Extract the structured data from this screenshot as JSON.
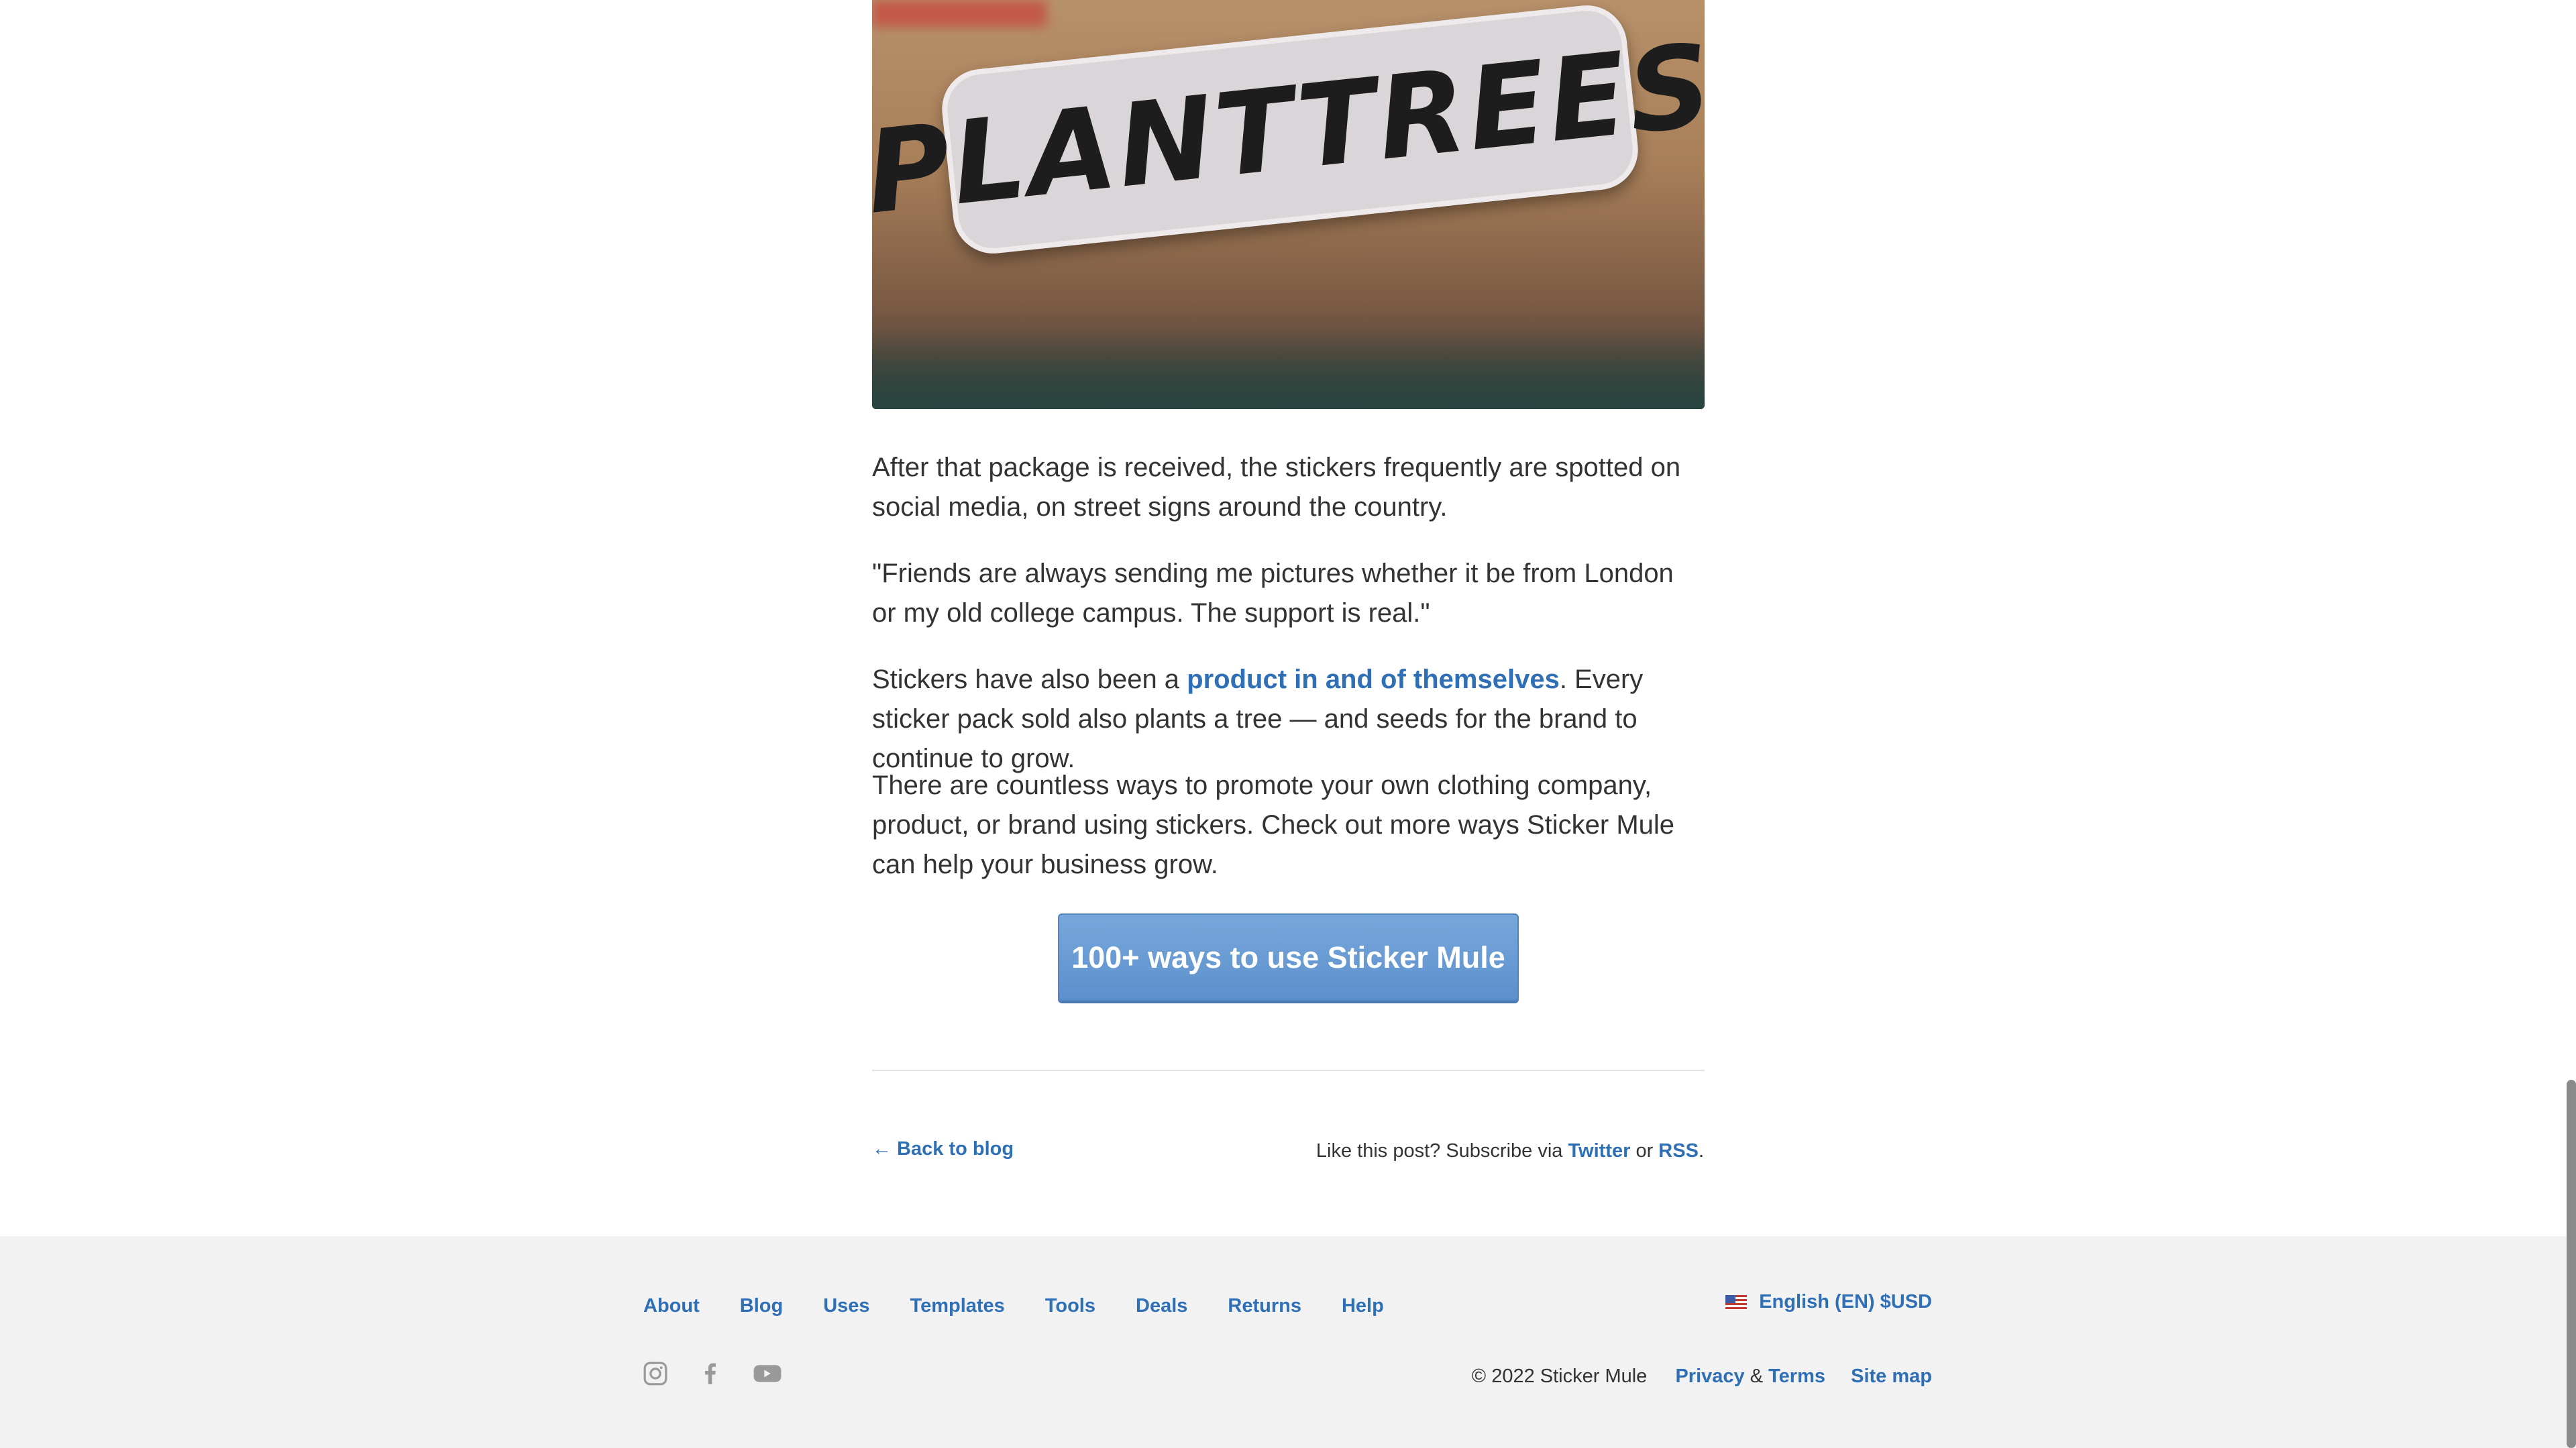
{
  "hero_image": {
    "sticker_text": "PLANTTREES"
  },
  "article": {
    "p1": "After that package is received, the stickers frequently are spotted on social media, on street signs around the country.",
    "p2": "\"Friends are always sending me pictures whether it be from London or my old college campus. The support is real.\"",
    "p3_before": "Stickers have also been a ",
    "p3_link": "product in and of themselves",
    "p3_after": ". Every sticker pack sold also plants a tree — and seeds for the brand to continue to grow.",
    "p4": "There are countless ways to promote your own clothing company, product, or brand using stickers. Check out more ways Sticker Mule can help your business grow."
  },
  "cta": {
    "label": "100+ ways to use Sticker Mule"
  },
  "post_footer": {
    "back_label": "← Back to blog",
    "subscribe_text": "Like this post? Subscribe via ",
    "twitter": "Twitter",
    "or": " or ",
    "rss": "RSS",
    "period": "."
  },
  "footer": {
    "nav": [
      "About",
      "Blog",
      "Uses",
      "Templates",
      "Tools",
      "Deals",
      "Returns",
      "Help"
    ],
    "language": "English (EN) $USD",
    "social_icons": [
      "instagram-icon",
      "facebook-icon",
      "youtube-icon"
    ],
    "copyright": "© 2022 Sticker Mule",
    "privacy": "Privacy",
    "amp": " & ",
    "terms": "Terms",
    "sitemap": "Site map"
  },
  "colors": {
    "link": "#2f6fb5",
    "cta": "#6b9bd4",
    "footer_bg": "#f2f2f2",
    "text": "#333333"
  }
}
